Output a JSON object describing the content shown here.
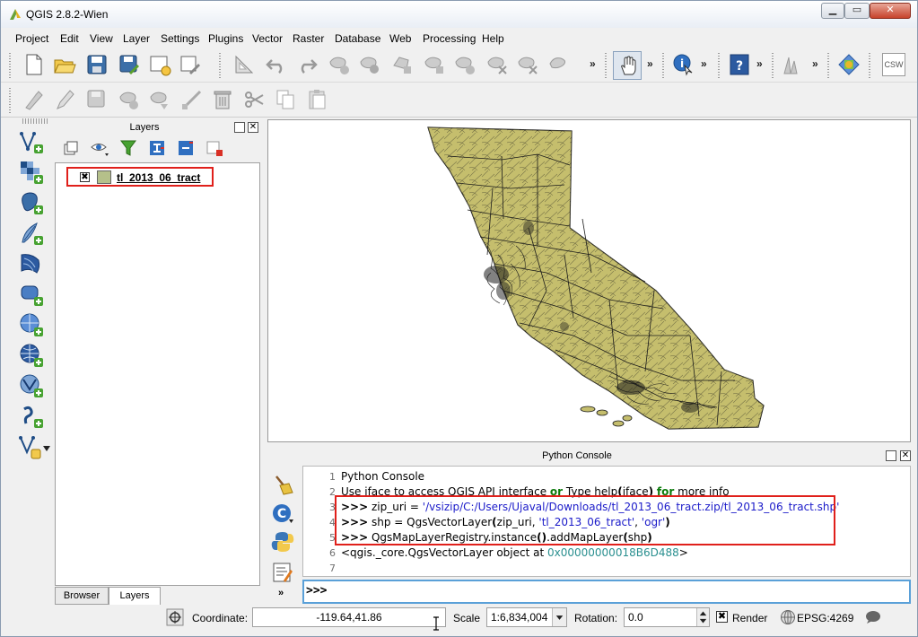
{
  "window": {
    "title": "QGIS 2.8.2-Wien"
  },
  "menu": [
    "Project",
    "Edit",
    "View",
    "Layer",
    "Settings",
    "Plugins",
    "Vector",
    "Raster",
    "Database",
    "Web",
    "Processing",
    "Help"
  ],
  "toolbar": {
    "more": "»",
    "csw_label": "CSW"
  },
  "layers_panel": {
    "title": "Layers",
    "layer_name": "tl_2013_06_tract",
    "tab_browser": "Browser",
    "tab_layers": "Layers"
  },
  "python_console": {
    "title": "Python Console",
    "prompt": ">>>",
    "lines": {
      "l1": {
        "num": "1",
        "text": "Python Console"
      },
      "l2": {
        "num": "2",
        "a": "Use iface to access QGIS API interface ",
        "or": "or",
        "b": " Type help",
        "c": "(",
        "d": "iface",
        "e": ")",
        "f": " ",
        "for": "for",
        "g": " more info"
      },
      "l3": {
        "num": "3",
        "prompt": ">>>",
        "a": " zip_uri = ",
        "str": "'/vsizip/C:/Users/Ujaval/Downloads/tl_2013_06_tract.zip/tl_2013_06_tract.shp'"
      },
      "l4": {
        "num": "4",
        "prompt": ">>>",
        "a": " shp =  QgsVectorLayer",
        "p1": "(",
        "b": "zip_uri, ",
        "s1": "'tl_2013_06_tract'",
        "c": ", ",
        "s2": "'ogr'",
        "p2": ")"
      },
      "l5": {
        "num": "5",
        "prompt": ">>>",
        "a": " QgsMapLayerRegistry.instance",
        "p1": "()",
        "b": ".addMapLayer",
        "p2": "(",
        "c": "shp",
        "p3": ")"
      },
      "l6": {
        "num": "6",
        "a": "<qgis._core.QgsVectorLayer object at ",
        "hex": "0x00000000018B6D488",
        "b": ">"
      },
      "l7": {
        "num": "7"
      }
    }
  },
  "statusbar": {
    "coordinate_label": "Coordinate:",
    "coordinate_value": "-119.64,41.86",
    "scale_label": "Scale",
    "scale_value": "1:6,834,004",
    "rotation_label": "Rotation:",
    "rotation_value": "0.0",
    "render_label": "Render",
    "epsg_label": "EPSG:4269"
  },
  "colors": {
    "highlight": "#e0201b",
    "feature_fill": "#c5be6d",
    "feature_stroke": "#1a1a1a"
  }
}
